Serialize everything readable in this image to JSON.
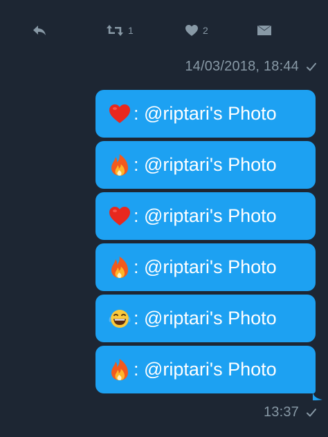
{
  "actions": {
    "reply_icon": "reply-icon",
    "retweet_count": "1",
    "like_count": "2",
    "dm_icon": "envelope-icon"
  },
  "timestamps": {
    "top": "14/03/2018, 18:44",
    "bottom": "13:37"
  },
  "messages": [
    {
      "emoji": "heart",
      "text": ": @riptari's Photo"
    },
    {
      "emoji": "fire",
      "text": ": @riptari's Photo"
    },
    {
      "emoji": "heart",
      "text": ": @riptari's Photo"
    },
    {
      "emoji": "fire",
      "text": ": @riptari's Photo"
    },
    {
      "emoji": "laughing",
      "text": ": @riptari's Photo"
    },
    {
      "emoji": "fire",
      "text": ": @riptari's Photo"
    }
  ],
  "colors": {
    "background": "#1d2633",
    "bubble": "#1da1f2",
    "muted": "#8899a6"
  }
}
